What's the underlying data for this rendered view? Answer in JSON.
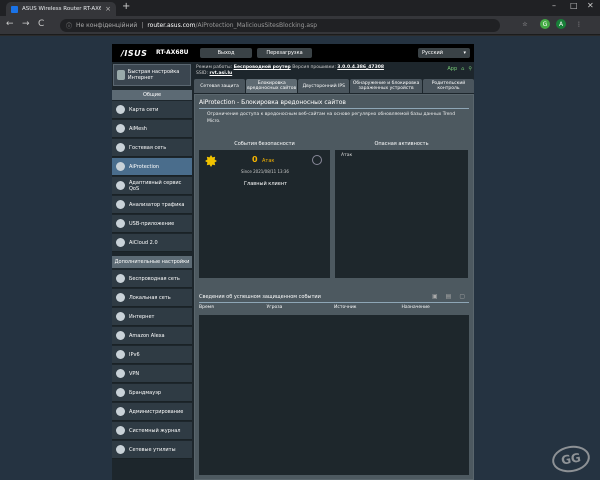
{
  "browser": {
    "tab_title": "ASUS Wireless Router RT-AX68...",
    "close": "×",
    "newtab": "+",
    "back": "←",
    "forward": "→",
    "reload": "C",
    "security": "Не конфіденційний",
    "host": "router.asus.com",
    "path": "/AiProtection_MaliciousSitesBlocking.asp",
    "avatar": "A",
    "menu": "⋮"
  },
  "router": {
    "logo": "/ISUS",
    "model": "RT-AX68U",
    "logout": "Выход",
    "reboot": "Перезагрузка",
    "language": "Русский",
    "status": {
      "mode_label": "Режим работы:",
      "mode_value": "Беспроводной роутер",
      "fw_label": "Версия прошивки:",
      "fw_value": "3.0.0.4.386_47308",
      "ssid_label": "SSID:",
      "ssid_value": "rvt.asi.lu",
      "app": "App"
    },
    "quick": "Быстрая настройка Интернет",
    "general_header": "Общие",
    "general_items": [
      "Карта сети",
      "AiMesh",
      "Гостевая сеть",
      "AiProtection",
      "Адаптивный сервис QoS",
      "Анализатор трафика",
      "USB-приложение",
      "AiCloud 2.0"
    ],
    "advanced_header": "Дополнительные настройки",
    "advanced_items": [
      "Беспроводная сеть",
      "Локальная сеть",
      "Интернет",
      "Amazon Alexa",
      "IPv6",
      "VPN",
      "Брандмауэр",
      "Администрирование",
      "Системный журнал",
      "Сетевые утилиты"
    ],
    "tabs": [
      "Сетевая защита",
      "Блокировка вредоносных сайтов",
      "Двусторонний IPS",
      "Обнаружение и блокировка зараженных устройств",
      "Родительский контроль"
    ],
    "panel": {
      "title": "AiProtection - Блокировка вредоносных сайтов",
      "desc": "Ограничение доступа к вредоносным веб-сайтам на основе регулярно обновляемой базы данных Trend Micro.",
      "events_title": "События безопасности",
      "activity_title": "Опасная активность",
      "count": "0",
      "count_label": "Атак",
      "since": "Since 2021/08/11 13:36",
      "client": "Главный клиент",
      "activity_label": "Атак",
      "table_title": "Сведения об успешном защищенном событии",
      "columns": [
        "Время",
        "Угроза",
        "Источник",
        "Назначение"
      ]
    }
  },
  "watermark": "GG"
}
